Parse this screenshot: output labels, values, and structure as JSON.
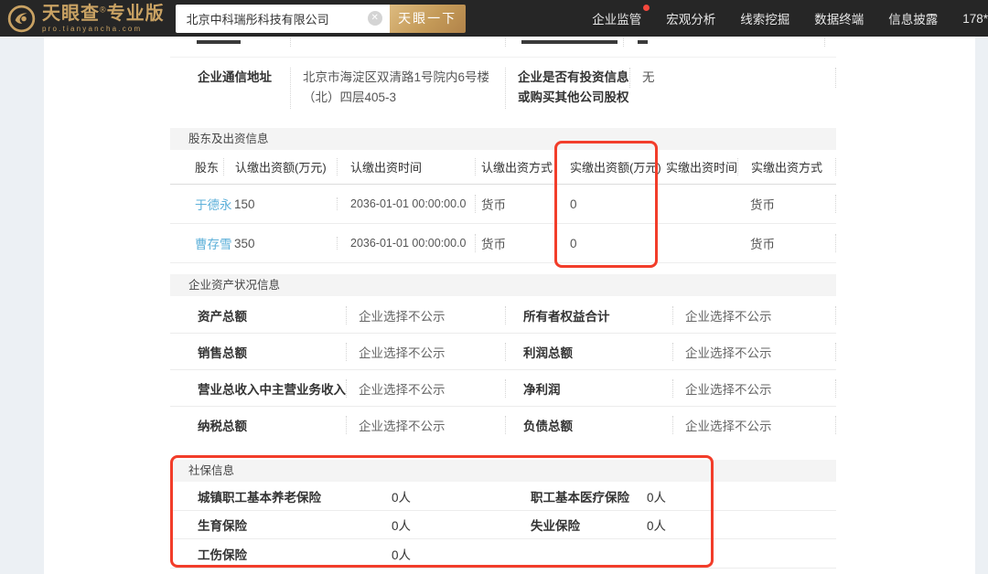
{
  "header": {
    "logo": {
      "title_main": "天眼查",
      "reg": "®",
      "title_sub": "专业版",
      "domain": "pro.tianyancha.com"
    },
    "search": {
      "value": "北京中科瑞彤科技有限公司",
      "clear_glyph": "✕",
      "button_label": "天眼一下"
    },
    "nav": [
      {
        "label": "企业监管"
      },
      {
        "label": "宏观分析"
      },
      {
        "label": "线索挖掘"
      },
      {
        "label": "数据终端"
      },
      {
        "label": "信息披露"
      },
      {
        "label": "178*"
      }
    ]
  },
  "info_row": {
    "label1": "企业通信地址",
    "value1": "北京市海淀区双清路1号院内6号楼（北）四层405-3",
    "label2": "企业是否有投资信息或购买其他公司股权",
    "value2": "无"
  },
  "shareholders": {
    "section_title": "股东及出资信息",
    "columns": [
      "股东",
      "认缴出资额(万元)",
      "认缴出资时间",
      "认缴出资方式",
      "实缴出资额(万元)",
      "实缴出资时间",
      "实缴出资方式"
    ],
    "rows": [
      {
        "name": "于德永",
        "sub_amount": "150",
        "sub_time": "2036-01-01 00:00:00.0",
        "sub_method": "货币",
        "paid_amount": "0",
        "paid_time": "",
        "paid_method": "货币"
      },
      {
        "name": "曹存雪",
        "sub_amount": "350",
        "sub_time": "2036-01-01 00:00:00.0",
        "sub_method": "货币",
        "paid_amount": "0",
        "paid_time": "",
        "paid_method": "货币"
      }
    ]
  },
  "assets": {
    "section_title": "企业资产状况信息",
    "rows": [
      {
        "label1": "资产总额",
        "value1": "企业选择不公示",
        "label2": "所有者权益合计",
        "value2": "企业选择不公示"
      },
      {
        "label1": "销售总额",
        "value1": "企业选择不公示",
        "label2": "利润总额",
        "value2": "企业选择不公示"
      },
      {
        "label1": "营业总收入中主营业务收入",
        "value1": "企业选择不公示",
        "label2": "净利润",
        "value2": "企业选择不公示"
      },
      {
        "label1": "纳税总额",
        "value1": "企业选择不公示",
        "label2": "负债总额",
        "value2": "企业选择不公示"
      }
    ]
  },
  "social": {
    "section_title": "社保信息",
    "rows": [
      {
        "label1": "城镇职工基本养老保险",
        "value1": "0人",
        "label2": "职工基本医疗保险",
        "value2": "0人"
      },
      {
        "label1": "生育保险",
        "value1": "0人",
        "label2": "失业保险",
        "value2": "0人"
      },
      {
        "label1": "工伤保险",
        "value1": "0人",
        "label2": "",
        "value2": ""
      }
    ]
  },
  "colors": {
    "header_bg": "#262626",
    "brand_gold": "#c9a263",
    "highlight_red": "#f23d2a",
    "link_blue": "#5db0d9",
    "section_bar_bg": "#f4f4f4"
  }
}
